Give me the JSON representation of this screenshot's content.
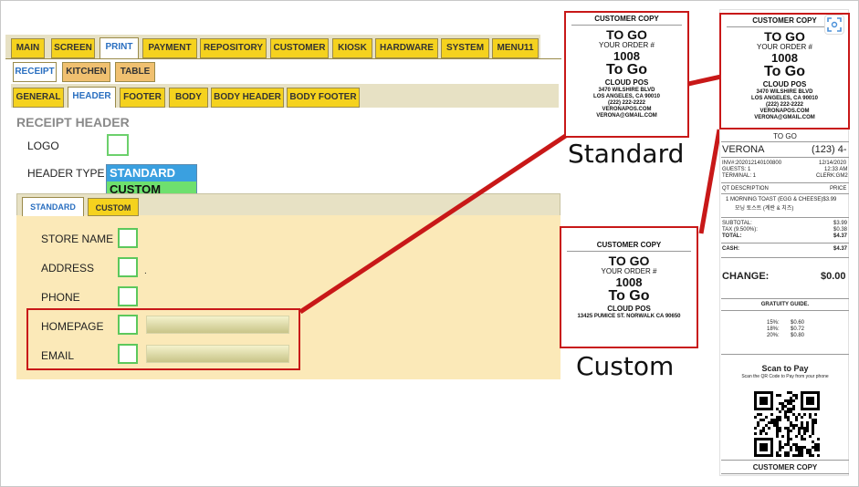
{
  "menu": {
    "top_tabs": [
      "MAIN",
      "SCREEN",
      "PRINT",
      "PAYMENT",
      "REPOSITORY",
      "CUSTOMER",
      "KIOSK",
      "HARDWARE",
      "SYSTEM",
      "MENU11"
    ],
    "sub_tabs": [
      "RECEIPT",
      "KITCHEN",
      "TABLE"
    ],
    "section_tabs": [
      "GENERAL",
      "HEADER",
      "FOOTER",
      "BODY",
      "BODY HEADER",
      "BODY FOOTER"
    ]
  },
  "receipt_header": {
    "title": "RECEIPT HEADER",
    "logo_label": "LOGO",
    "header_type_label": "HEADER TYPE",
    "header_type_options": [
      "STANDARD",
      "CUSTOM"
    ],
    "inner_tabs": [
      "STANDARD",
      "CUSTOM"
    ],
    "fields": {
      "store_name": "STORE NAME",
      "address": "ADDRESS",
      "phone": "PHONE",
      "homepage": "HOMEPAGE",
      "email": "EMAIL"
    },
    "address_mark": "."
  },
  "captions": {
    "standard": "Standard",
    "custom": "Custom"
  },
  "standard_receipt": {
    "copy": "CUSTOMER COPY",
    "to_go": "TO GO",
    "order_label": "YOUR ORDER #",
    "order_no": "1008",
    "to_go2": "To Go",
    "store": "CLOUD POS",
    "addr1": "3470 WILSHIRE BLVD",
    "addr2": "LOS ANGELES, CA 90010",
    "phone": "(222) 222-2222",
    "web": "VERONAPOS.COM",
    "email": "VERONA@GMAIL.COM"
  },
  "custom_receipt": {
    "copy": "CUSTOMER COPY",
    "to_go": "TO GO",
    "order_label": "YOUR ORDER #",
    "order_no": "1008",
    "to_go2": "To Go",
    "store": "CLOUD POS",
    "addr": "13425 PUMICE ST. NORWALK CA 90650"
  },
  "full_receipt": {
    "copy": "CUSTOMER COPY",
    "to_go": "TO GO",
    "order_label": "YOUR ORDER #",
    "order_no": "1008",
    "to_go2": "To Go",
    "store": "CLOUD POS",
    "addr1": "3470 WILSHIRE BLVD",
    "addr2": "LOS ANGELES, CA 90010",
    "phone": "(222) 222-2222",
    "web": "VERONAPOS.COM",
    "email": "VERONA@GMAIL.COM",
    "to_go_line": "TO GO",
    "verona": "VERONA",
    "verona_phone": "(123) 4-",
    "inv": "INV#:202012140100800",
    "date": "12/14/2020",
    "guests": "GUESTS: 1",
    "time": "12:33 AM",
    "terminal": "TERMINAL: 1",
    "clerk": "CLERK:GM2",
    "col_left": "QT DESCRIPTION",
    "col_right": "PRICE",
    "item": "1 MORNING TOAST (EGG & CHEESE)$3.99",
    "item_kr": "모닝 토스트 (계란 & 치즈)",
    "subtotal_label": "SUBTOTAL:",
    "subtotal": "$3.99",
    "tax_label": "TAX (9.500%):",
    "tax": "$0.38",
    "total_label": "TOTAL:",
    "total": "$4.37",
    "cash_label": "CASH:",
    "cash": "$4.37",
    "change_label": "CHANGE:",
    "change": "$0.00",
    "gratuity": "GRATUITY GUIDE.",
    "g15": "15%:",
    "g15v": "$0.60",
    "g18": "18%:",
    "g18v": "$0.72",
    "g20": "20%:",
    "g20v": "$0.80",
    "scan": "Scan to Pay",
    "scan_sub": "Scan the QR Code to Pay from your phone",
    "bottom_copy": "CUSTOMER COPY"
  }
}
